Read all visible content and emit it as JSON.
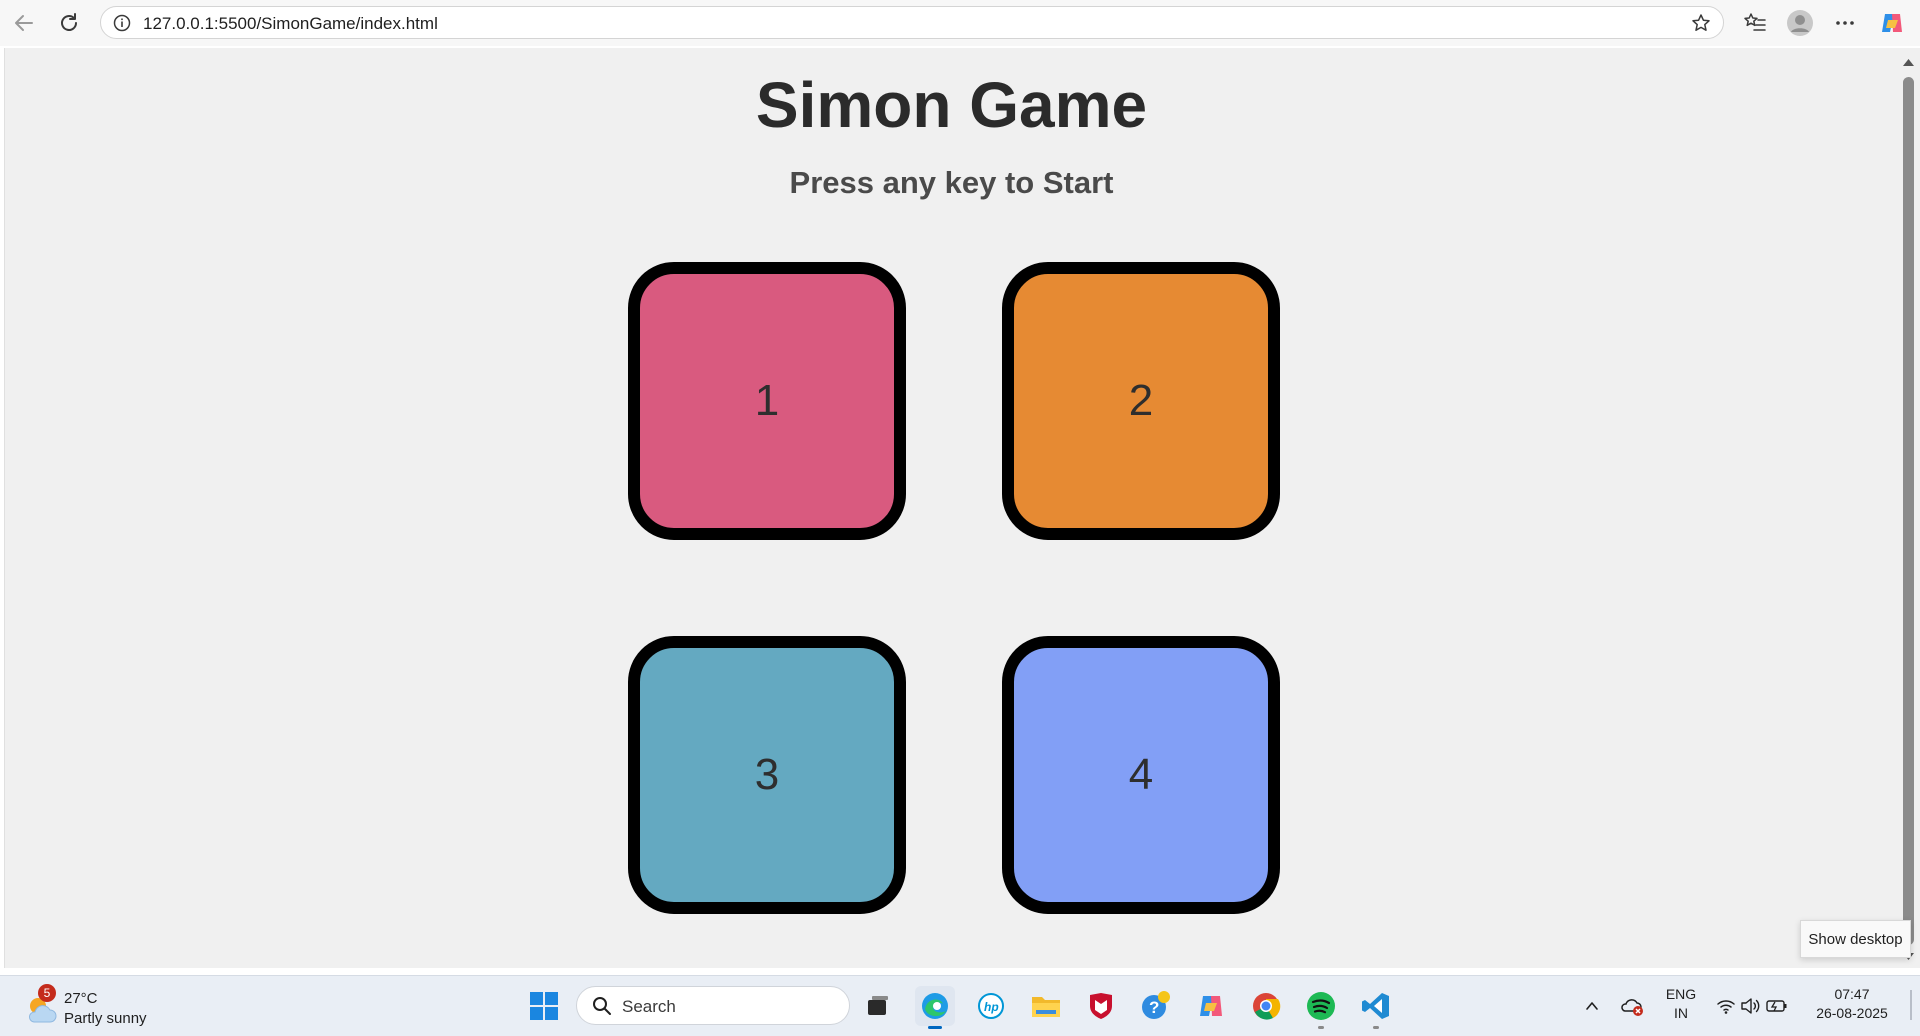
{
  "browser": {
    "url": "127.0.0.1:5500/SimonGame/index.html"
  },
  "page": {
    "title": "Simon Game",
    "subtitle": "Press any key to Start",
    "buttons": [
      {
        "label": "1",
        "color": "#d95a7f"
      },
      {
        "label": "2",
        "color": "#e68a33"
      },
      {
        "label": "3",
        "color": "#64a9c1"
      },
      {
        "label": "4",
        "color": "#829ff6"
      }
    ]
  },
  "tooltip": {
    "text": "Show desktop"
  },
  "taskbar": {
    "weather": {
      "badge": "5",
      "temperature": "27°C",
      "description": "Partly sunny"
    },
    "search_placeholder": "Search",
    "tray": {
      "language": "ENG",
      "region": "IN",
      "time": "07:47",
      "date": "26-08-2025"
    }
  }
}
